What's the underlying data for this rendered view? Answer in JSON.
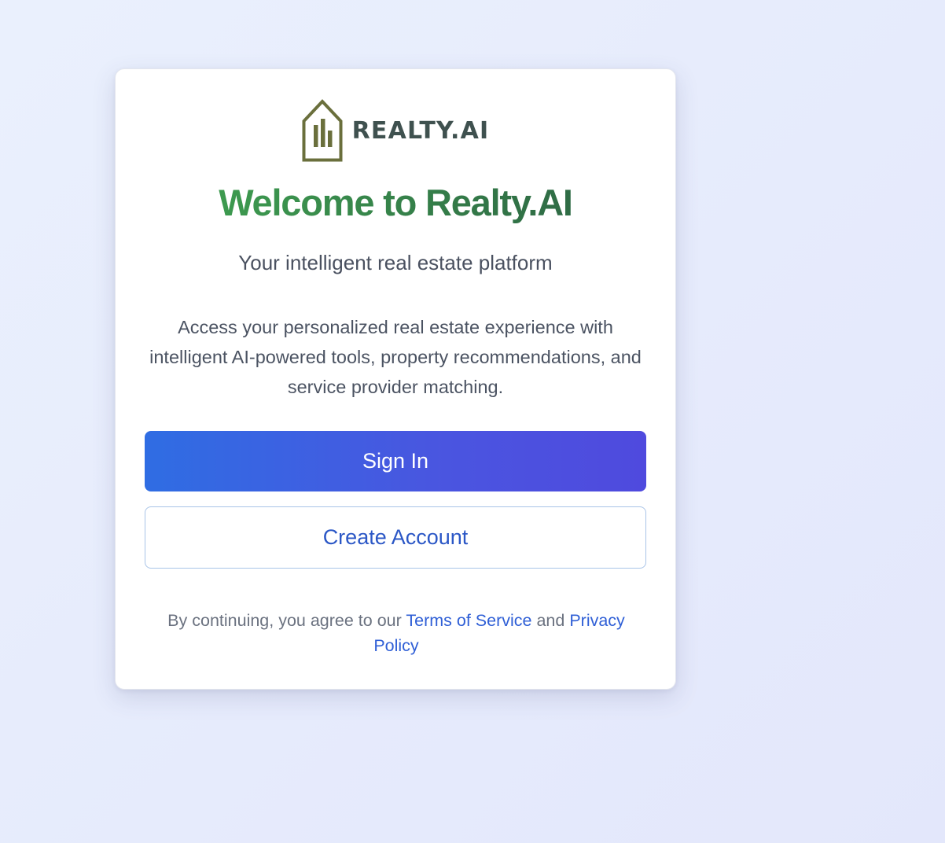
{
  "brand": {
    "logo_text": "REALTY.AI",
    "logo_icon": "house-bar-chart-icon",
    "logo_color": "#6a6f3c",
    "logo_text_color": "#3f514f"
  },
  "welcome": {
    "title": "Welcome to Realty.AI",
    "subtitle": "Your intelligent real estate platform",
    "description": "Access your personalized real estate experience with intelligent AI-powered tools, property recommendations, and service provider matching."
  },
  "actions": {
    "sign_in_label": "Sign In",
    "create_account_label": "Create Account"
  },
  "legal": {
    "prefix": "By continuing, you agree to our",
    "terms_label": "Terms of Service",
    "conjunction": "and",
    "privacy_label": "Privacy Policy"
  },
  "colors": {
    "title_gradient_start": "#3d9a4f",
    "title_gradient_end": "#2f6b45",
    "primary_gradient_start": "#2f6de3",
    "primary_gradient_end": "#4f4ade",
    "link": "#2f5fd6"
  }
}
